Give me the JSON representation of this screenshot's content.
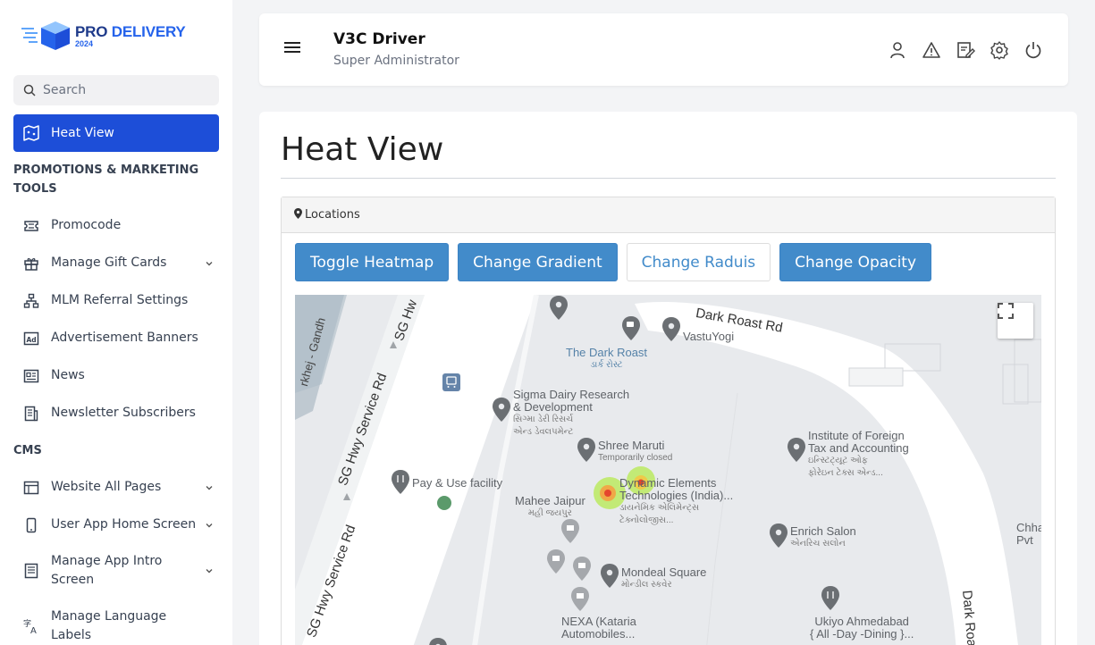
{
  "logo": {
    "brand_part1": "PRO",
    "brand_part2": "DELIVERY",
    "year": "2024"
  },
  "search": {
    "placeholder": "Search"
  },
  "sidebar": {
    "active_item": "Heat View",
    "sections": [
      {
        "title": "PROMOTIONS & MARKETING TOOLS"
      },
      {
        "title": "CMS"
      }
    ],
    "items": [
      {
        "label": "Promocode",
        "icon": "ticket-icon"
      },
      {
        "label": "Manage Gift Cards",
        "icon": "gift-icon",
        "expandable": true
      },
      {
        "label": "MLM Referral Settings",
        "icon": "hierarchy-icon"
      },
      {
        "label": "Advertisement Banners",
        "icon": "ad-icon"
      },
      {
        "label": "News",
        "icon": "newspaper-icon"
      },
      {
        "label": "Newsletter Subscribers",
        "icon": "newsletter-icon"
      },
      {
        "label": "Website All Pages",
        "icon": "browser-icon",
        "expandable": true
      },
      {
        "label": "User App Home Screen",
        "icon": "mobile-icon",
        "expandable": true
      },
      {
        "label": "Manage App Intro Screen",
        "icon": "intro-icon",
        "expandable": true
      },
      {
        "label": "Manage Language Labels",
        "icon": "language-icon"
      }
    ]
  },
  "header": {
    "user_name": "V3C Driver",
    "user_role": "Super Administrator",
    "icons": [
      "user-icon",
      "alert-icon",
      "edit-note-icon",
      "settings-icon",
      "power-icon"
    ]
  },
  "main": {
    "title": "Heat View",
    "panel_title": "Locations",
    "buttons": {
      "toggle": "Toggle Heatmap",
      "gradient": "Change Gradient",
      "radius": "Change Raduis",
      "opacity": "Change Opacity"
    }
  },
  "map": {
    "roads": {
      "dark_roast": "Dark Roast Rd",
      "sg_hwy_1": "SG Hwy Service Rd",
      "sg_hwy_2": "SG Hwy Service Rd",
      "sg_hwy_top": "SG Hw",
      "gandhi": "rkhej - Gandh",
      "dark_roast_vertical": "Dark Roa"
    },
    "pois": {
      "dark_roast": "The Dark Roast",
      "dark_roast_sub": "ડાર્ક રોસ્ટ",
      "vastuyogi": "VastuYogi",
      "sigma_1": "Sigma Dairy Research",
      "sigma_2": "& Development",
      "sigma_sub1": "સિગ્મા ડેરી રિસર્ચ",
      "sigma_sub2": "એન્ડ ડેવલપમેન્ટ",
      "shree_maruti": "Shree Maruti",
      "shree_maruti_sub": "Temporarily closed",
      "institute_1": "Institute of Foreign",
      "institute_2": "Tax and Accounting",
      "institute_sub1": "ઇન્સ્ટિટ્યૂટ ઓફ",
      "institute_sub2": "ફોરેઇન ટેક્સ એન્ડ...",
      "pay_use": "Pay & Use facility",
      "dynamic_1": "Dynamic Elements",
      "dynamic_2": "Technologies (India)...",
      "dynamic_sub1": "ડાયનેમિક એલિમેન્ટ્સ",
      "dynamic_sub2": "ટેક્નોલોજીસ...",
      "mahee": "Mahee Jaipur",
      "mahee_sub": "મહી જયપુર",
      "enrich": "Enrich Salon",
      "enrich_sub": "એનરિચ સલોન",
      "mondeal": "Mondeal Square",
      "mondeal_sub": "મોન્ડીલ સ્કવેર",
      "nexa_1": "NEXA (Kataria",
      "nexa_2": "Automobiles...",
      "ukiyo_1": "Ukiyo Ahmedabad",
      "ukiyo_2": "{ All -Day -Dining }...",
      "chha_1": "Chha",
      "chha_2": "Pvt"
    }
  }
}
